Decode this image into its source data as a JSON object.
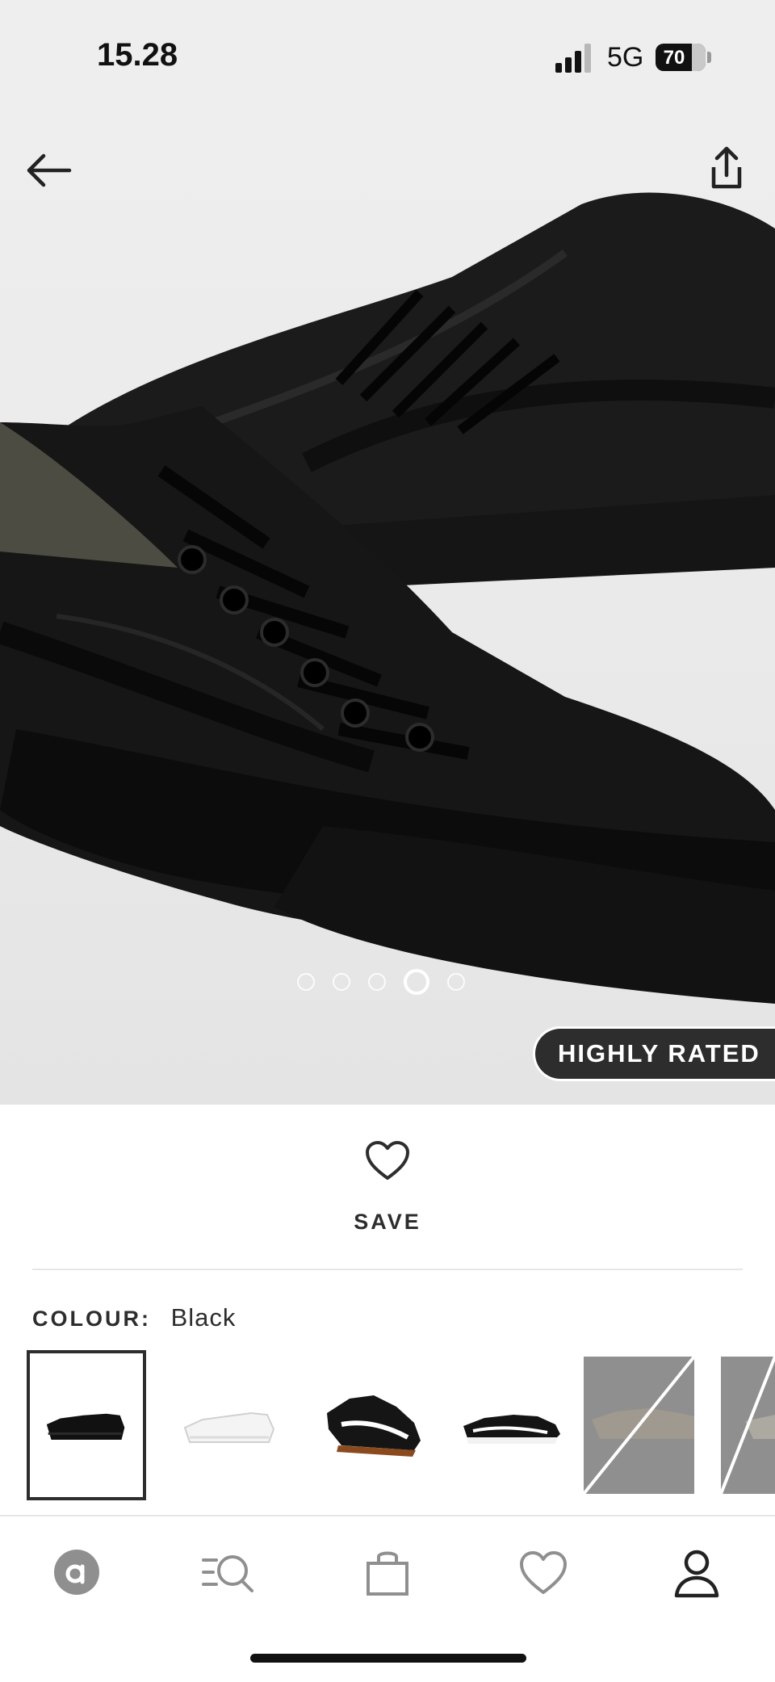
{
  "status_bar": {
    "time": "15.28",
    "network": "5G",
    "battery": "70"
  },
  "product": {
    "gallery": {
      "image_count": 5,
      "active_index": 3
    },
    "badge": "HIGHLY RATED"
  },
  "save": {
    "label": "SAVE"
  },
  "colour": {
    "label": "COLOUR:",
    "value": "Black",
    "swatches": [
      {
        "name": "black",
        "selected": true,
        "available": true
      },
      {
        "name": "white",
        "selected": false,
        "available": true
      },
      {
        "name": "black-gum",
        "selected": false,
        "available": true
      },
      {
        "name": "black-white",
        "selected": false,
        "available": true
      },
      {
        "name": "grey",
        "selected": false,
        "available": false
      },
      {
        "name": "grey-2",
        "selected": false,
        "available": false
      }
    ]
  },
  "bottom_nav": {
    "items": [
      "home-icon",
      "search-icon",
      "bag-icon",
      "saved-icon",
      "account-icon"
    ]
  },
  "colors": {
    "text": "#2d2d2d",
    "badge_bg": "#2d2d2d",
    "status_bar_bg": "#eeeeee"
  }
}
